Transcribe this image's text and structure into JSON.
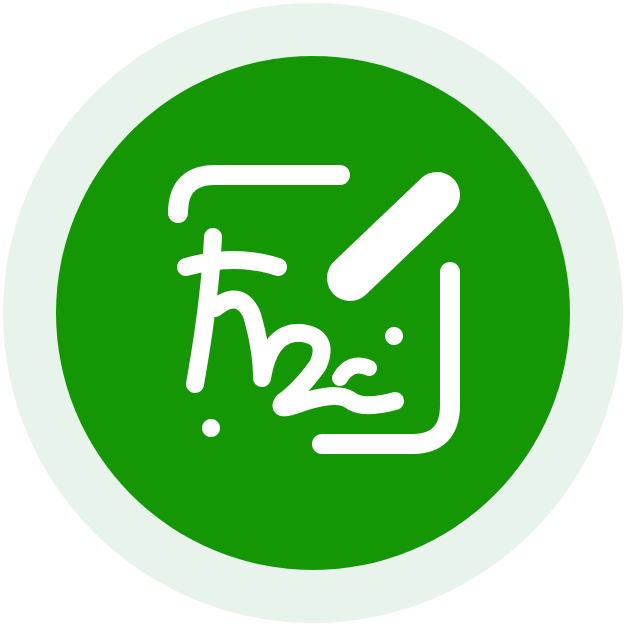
{
  "icon": {
    "name": "signature-edit-icon",
    "colors": {
      "halo": "#e8f3ec",
      "disc": "#149605",
      "glyph": "#ffffff"
    }
  }
}
